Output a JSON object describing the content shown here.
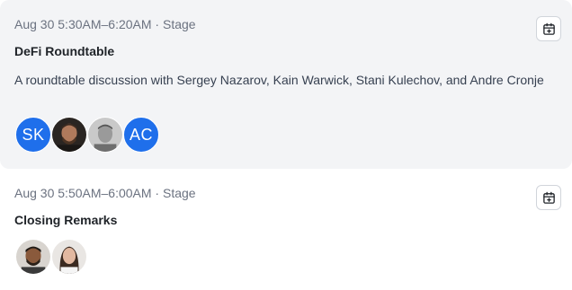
{
  "events": [
    {
      "meta": "Aug 30 5:30AM–6:20AM · Stage",
      "title": "DeFi Roundtable",
      "description": "A roundtable discussion with Sergey Nazarov, Kain Warwick, Stani Kulechov, and Andre Cronje",
      "calendar_icon": "calendar-add-icon",
      "speakers": [
        {
          "type": "initials",
          "initials": "SK"
        },
        {
          "type": "photo",
          "icon": "speaker-photo-icon"
        },
        {
          "type": "photo",
          "icon": "speaker-photo-icon"
        },
        {
          "type": "initials",
          "initials": "AC"
        }
      ]
    },
    {
      "meta": "Aug 30 5:50AM–6:00AM · Stage",
      "title": "Closing Remarks",
      "calendar_icon": "calendar-add-icon",
      "speakers": [
        {
          "type": "photo",
          "icon": "speaker-photo-icon"
        },
        {
          "type": "photo",
          "icon": "speaker-photo-icon"
        }
      ]
    }
  ],
  "colors": {
    "initials_avatar_bg": "#1f6feb",
    "highlight_card_bg": "#f3f4f6",
    "meta_text": "#6b7280"
  }
}
